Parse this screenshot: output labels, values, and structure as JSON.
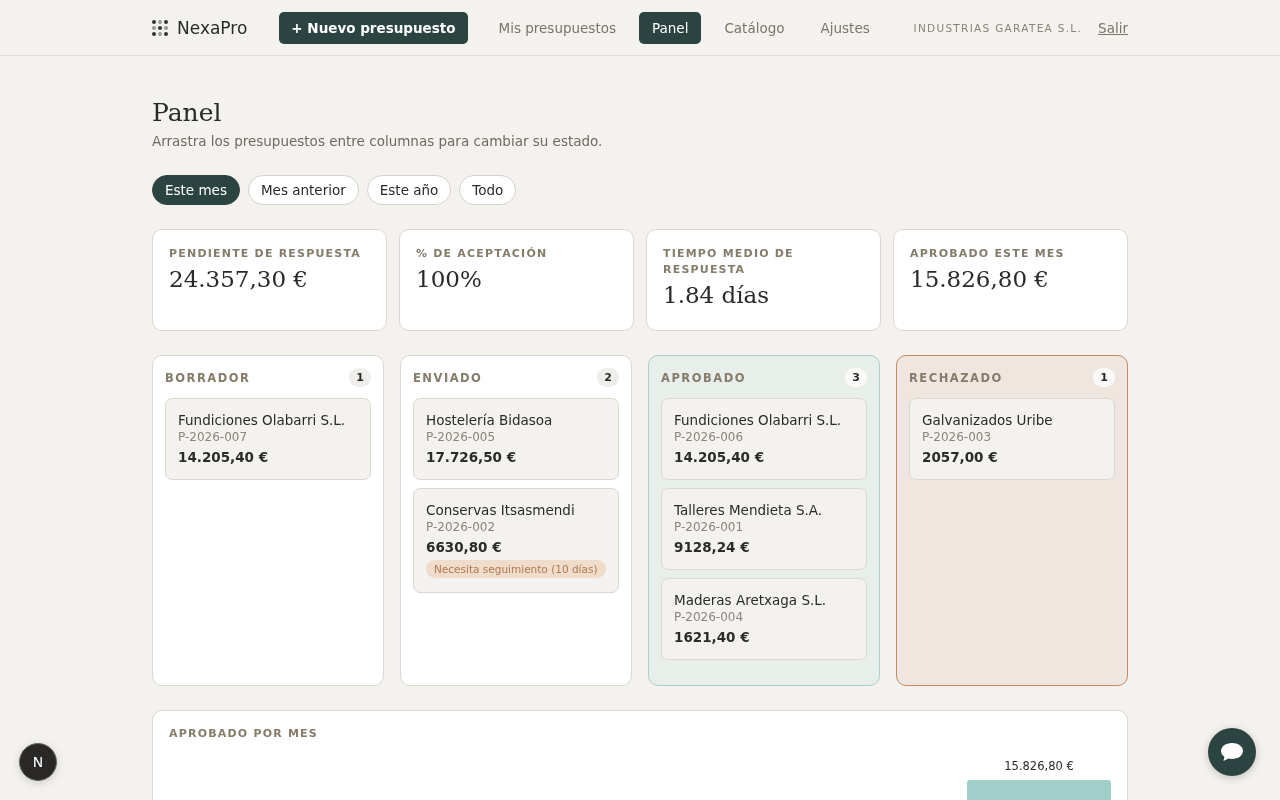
{
  "nav": {
    "brand": "NexaPro",
    "new_button": "+ Nuevo presupuesto",
    "links": [
      {
        "label": "Mis presupuestos",
        "selected": false
      },
      {
        "label": "Panel",
        "selected": true
      },
      {
        "label": "Catálogo",
        "selected": false
      },
      {
        "label": "Ajustes",
        "selected": false
      }
    ],
    "company": "INDUSTRIAS GARATEA S.L.",
    "logout": "Salir"
  },
  "page": {
    "title": "Panel",
    "subtitle": "Arrastra los presupuestos entre columnas para cambiar su estado."
  },
  "filters": [
    {
      "label": "Este mes",
      "selected": true
    },
    {
      "label": "Mes anterior",
      "selected": false
    },
    {
      "label": "Este año",
      "selected": false
    },
    {
      "label": "Todo",
      "selected": false
    }
  ],
  "stats": [
    {
      "label": "PENDIENTE DE RESPUESTA",
      "value": "24.357,30 €"
    },
    {
      "label": "% DE ACEPTACIÓN",
      "value": "100%"
    },
    {
      "label": "TIEMPO MEDIO DE RESPUESTA",
      "value": "1.84 días"
    },
    {
      "label": "APROBADO ESTE MES",
      "value": "15.826,80 €"
    }
  ],
  "columns": [
    {
      "title": "BORRADOR",
      "count": "1",
      "kind": "draft",
      "cards": [
        {
          "client": "Fundiciones Olabarri S.L.",
          "ref": "P-2026-007",
          "amount": "14.205,40 €"
        }
      ]
    },
    {
      "title": "ENVIADO",
      "count": "2",
      "kind": "sent",
      "cards": [
        {
          "client": "Hostelería Bidasoa",
          "ref": "P-2026-005",
          "amount": "17.726,50 €"
        },
        {
          "client": "Conservas Itsasmendi",
          "ref": "P-2026-002",
          "amount": "6630,80 €",
          "tag": "Necesita seguimiento (10 días)"
        }
      ]
    },
    {
      "title": "APROBADO",
      "count": "3",
      "kind": "approved",
      "cards": [
        {
          "client": "Fundiciones Olabarri S.L.",
          "ref": "P-2026-006",
          "amount": "14.205,40 €"
        },
        {
          "client": "Talleres Mendieta S.A.",
          "ref": "P-2026-001",
          "amount": "9128,24 €"
        },
        {
          "client": "Maderas Aretxaga S.L.",
          "ref": "P-2026-004",
          "amount": "1621,40 €"
        }
      ]
    },
    {
      "title": "RECHAZADO",
      "count": "1",
      "kind": "rejected",
      "cards": [
        {
          "client": "Galvanizados Uribe",
          "ref": "P-2026-003",
          "amount": "2057,00 €"
        }
      ]
    }
  ],
  "chart": {
    "title": "APROBADO POR MES",
    "bar_label": "15.826,80 €"
  },
  "dev_badge": "N"
}
